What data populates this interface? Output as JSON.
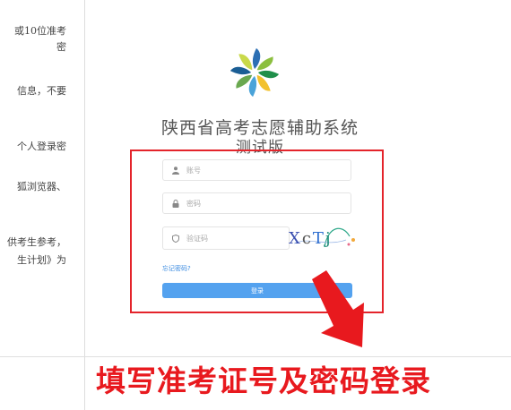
{
  "left_column": {
    "lines": [
      "或10位准考",
      "密",
      "信息，不要",
      "个人登录密",
      "狐浏览器、",
      "供考生参考，",
      "生计划》为"
    ]
  },
  "brand": {
    "title": "陕西省高考志愿辅助系统",
    "subtitle": "测试版",
    "logo_colors": [
      "#2c6fb4",
      "#8cbf3f",
      "#1f8f4a",
      "#f2c12e",
      "#4aa3d9",
      "#6aa84f",
      "#1b5e95",
      "#c9d94a"
    ]
  },
  "form": {
    "username_placeholder": "账号",
    "password_placeholder": "密码",
    "captcha_placeholder": "验证码",
    "captcha_chars": [
      "X",
      "c",
      "T",
      "j"
    ],
    "forgot_label": "忘记密码?",
    "login_label": "登录"
  },
  "annotation": {
    "caption": "填写准考证号及密码登录",
    "accent": "#e4242b"
  }
}
